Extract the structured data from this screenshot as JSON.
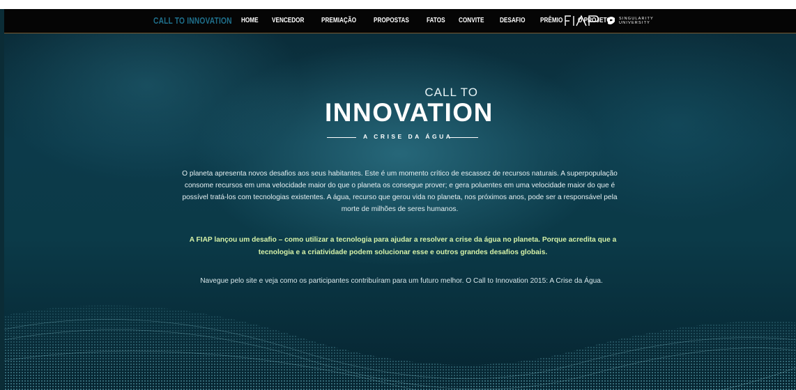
{
  "nav": {
    "brand": "CALL TO INNOVATION",
    "items": [
      {
        "label": "HOME"
      },
      {
        "label": "VENCEDOR"
      },
      {
        "label": "PREMIAÇÃO"
      },
      {
        "label": "PROPOSTAS"
      },
      {
        "label": "FATOS"
      },
      {
        "label": "CONVITE"
      },
      {
        "label": "DESAFIO"
      },
      {
        "label": "PRÊMIO"
      },
      {
        "label": "O PROJETO"
      }
    ],
    "fiap_logo": "FIAP",
    "singularity_line1": "SINGULARITY",
    "singularity_line2": "UNIVERSITY"
  },
  "hero": {
    "call_to": "CALL TO",
    "innovation": "INNOVATION",
    "subtitle": "A CRISE DA ÁGUA"
  },
  "content": {
    "intro": "O planeta apresenta novos desafios aos seus habitantes. Este é um momento crítico de escassez de recursos naturais. A superpopulação consome recursos em uma velocidade maior do que o planeta os consegue prover; e gera poluentes em uma velocidade maior do que é possível tratá-los com tecnologias existentes. A água, recurso que gerou vida no planeta, nos próximos anos, pode ser a responsável pela morte de milhões de seres humanos.",
    "highlight": "A FIAP lançou um desafio – como utilizar a tecnologia para ajudar a resolver a crise da água no planeta. Porque acredita que a tecnologia e a criatividade podem solucionar esse e outros grandes desafios globais.",
    "closing": "Navegue pelo site e veja como os participantes contribuíram para um futuro melhor. O Call to Innovation 2015: A Crise da Água."
  },
  "colors": {
    "brand": "#1f6f8b",
    "highlight": "#d6f2a8",
    "nav_bg": "#050505"
  }
}
